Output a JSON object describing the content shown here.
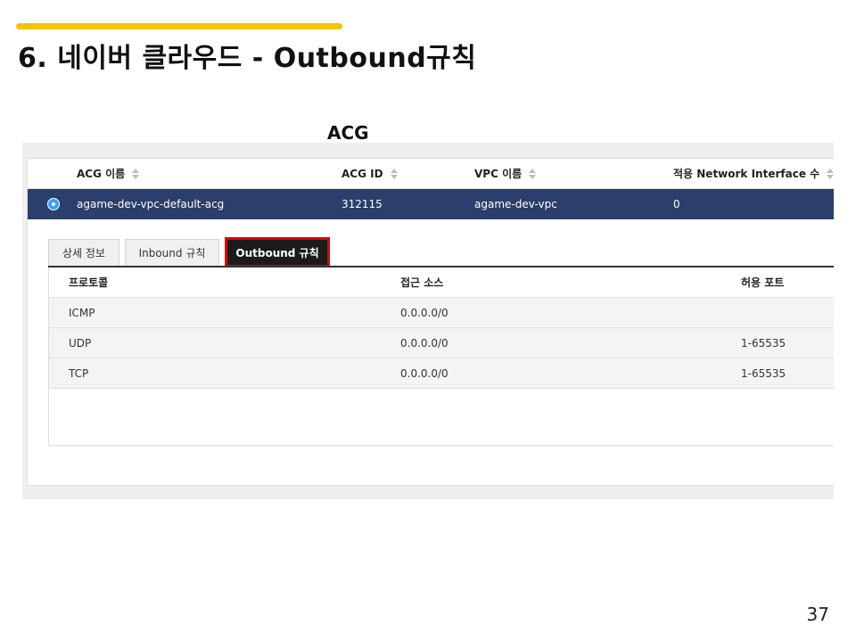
{
  "slide": {
    "title": "6. 네이버 클라우드 - Outbound규칙",
    "acg_caption": "ACG",
    "page_number": "37",
    "accent_color": "#f5c400"
  },
  "acg_table": {
    "columns": [
      "ACG 이름",
      "ACG ID",
      "VPC 이름",
      "적용 Network Interface 수"
    ],
    "rows": [
      {
        "name": "agame-dev-vpc-default-acg",
        "id": "312115",
        "vpc": "agame-dev-vpc",
        "nic_count": "0",
        "selected": true
      }
    ],
    "selected_row_color": "#2c3e6b"
  },
  "tabs": [
    {
      "label": "상세 정보",
      "active": false
    },
    {
      "label": "Inbound 규칙",
      "active": false
    },
    {
      "label": "Outbound 규칙",
      "active": true
    }
  ],
  "rules_table": {
    "columns": [
      "프로토콜",
      "접근 소스",
      "허용 포트"
    ],
    "rows": [
      {
        "protocol": "ICMP",
        "source": "0.0.0.0/0",
        "port": ""
      },
      {
        "protocol": "UDP",
        "source": "0.0.0.0/0",
        "port": "1-65535"
      },
      {
        "protocol": "TCP",
        "source": "0.0.0.0/0",
        "port": "1-65535"
      }
    ]
  },
  "highlight_color": "#e00000"
}
